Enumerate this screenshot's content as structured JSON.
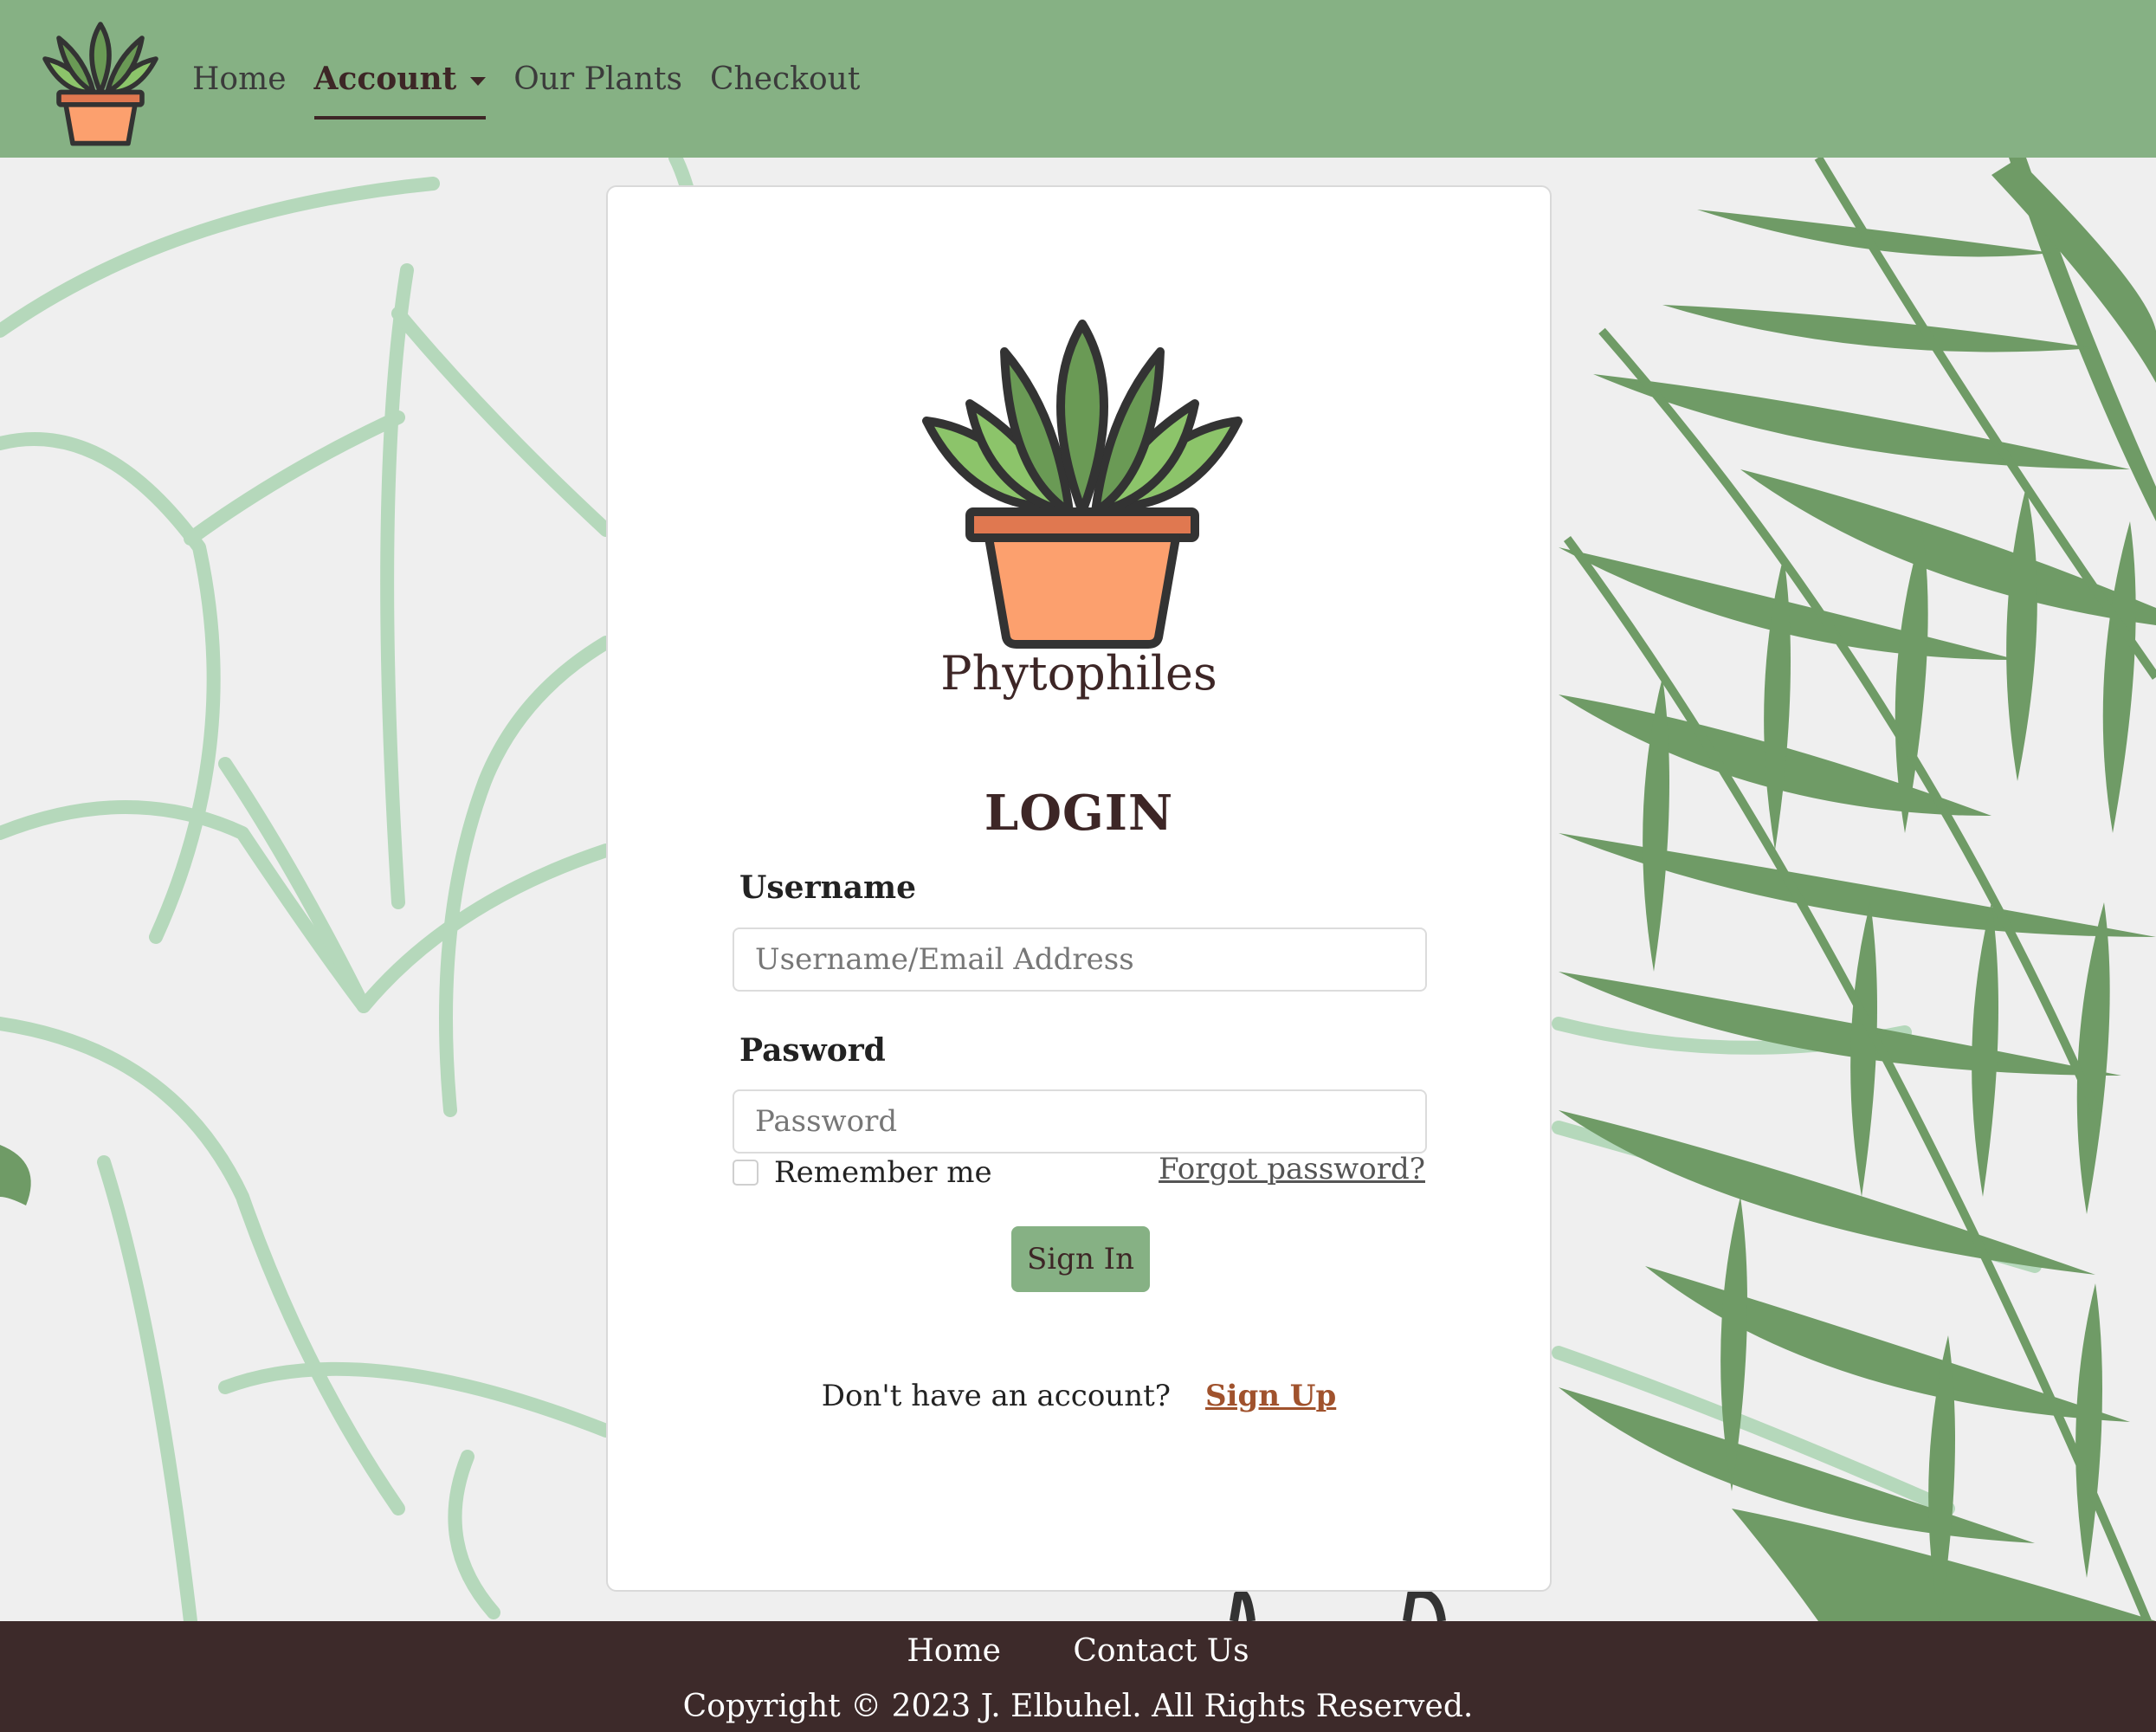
{
  "nav": {
    "items": [
      {
        "label": "Home"
      },
      {
        "label": "Account"
      },
      {
        "label": "Our Plants"
      },
      {
        "label": "Checkout"
      }
    ]
  },
  "login": {
    "brand": "Phytophiles",
    "title": "LOGIN",
    "username_label": "Username",
    "username_placeholder": "Username/Email Address",
    "password_label": "Pasword",
    "password_placeholder": "Password",
    "remember_label": "Remember me",
    "forgot_label": "Forgot password?",
    "signin_label": "Sign In",
    "no_account_text": "Don't have an account?",
    "signup_label": "Sign Up"
  },
  "footer": {
    "links": [
      {
        "label": "Home"
      },
      {
        "label": "Contact Us"
      }
    ],
    "copyright": "Copyright © 2023 J. Elbuhel. All Rights Reserved."
  },
  "colors": {
    "nav_bg": "#86b184",
    "footer_bg": "#3d2a2a",
    "accent_link": "#a0522d",
    "pot": "#fca06e",
    "leaf_dark": "#6a9a55",
    "leaf_light": "#8cc46a"
  }
}
